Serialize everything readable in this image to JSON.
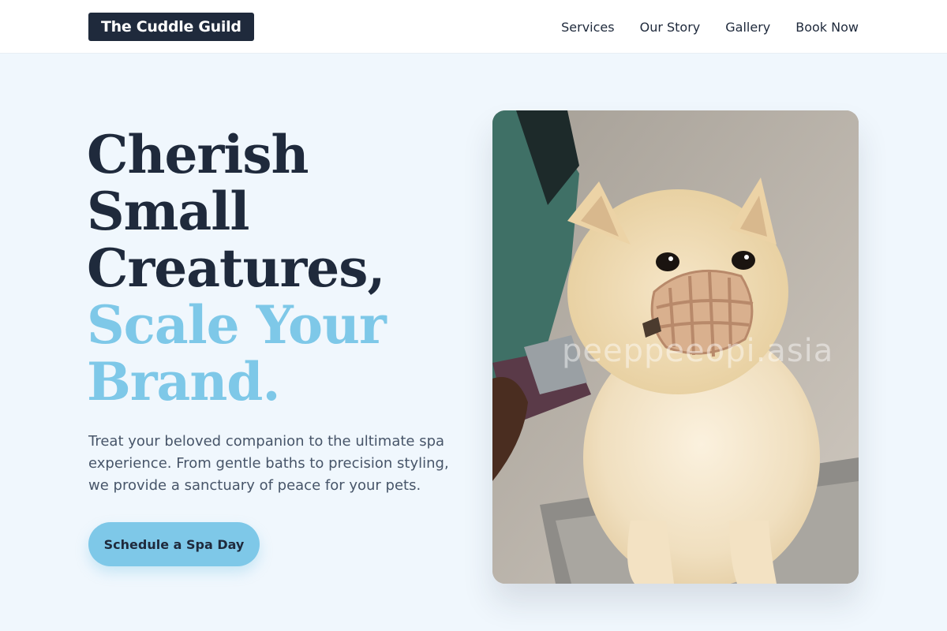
{
  "header": {
    "logo": "The Cuddle Guild",
    "nav": [
      "Services",
      "Our Story",
      "Gallery",
      "Book Now"
    ]
  },
  "hero": {
    "headline": {
      "line1": "Cherish",
      "line2": "Small",
      "line3": "Creatures,",
      "accent1": "Scale Your",
      "accent2": "Brand."
    },
    "lead": "Treat your beloved companion to the ultimate spa experience. From gentle baths to precision styling, we provide a sanctuary of peace for your pets.",
    "cta": "Schedule a Spa Day",
    "image": {
      "subject": "fluffy cream pomeranian wearing a muzzle being groomed",
      "watermark": "peeppeeopi.asia"
    }
  },
  "colors": {
    "page_bg": "#f0f7fd",
    "navy": "#1f2a3c",
    "accent": "#7ec8e8",
    "body_text": "#475569"
  }
}
